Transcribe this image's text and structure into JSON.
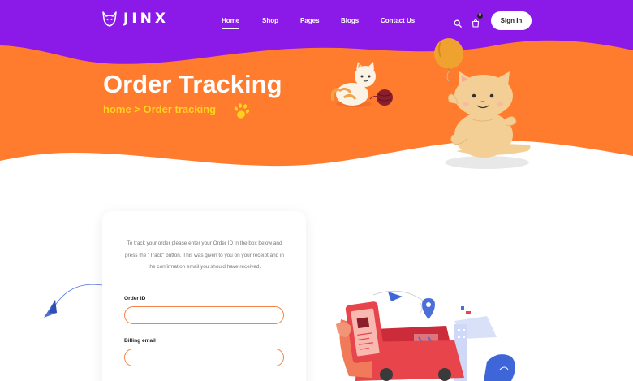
{
  "brand": {
    "name": "JINX",
    "colors": {
      "purple": "#8b1ae8",
      "orange": "#ff7b2e",
      "yellow": "#ffd21f"
    }
  },
  "nav": {
    "items": [
      {
        "label": "Home",
        "active": true
      },
      {
        "label": "Shop",
        "active": false
      },
      {
        "label": "Pages",
        "active": false
      },
      {
        "label": "Blogs",
        "active": false
      },
      {
        "label": "Contact Us",
        "active": false
      }
    ],
    "cart_count": "0",
    "signin_label": "Sign In",
    "icons": [
      "search-icon",
      "cart-icon"
    ]
  },
  "hero": {
    "title": "Order Tracking",
    "breadcrumb": {
      "home": "home",
      "separator": ">",
      "current": "Order tracking"
    }
  },
  "form": {
    "description": "To track your order please enter your Order ID in the box below and press the \"Track\" button. This was given to you on your receipt and in the confirmation email you should have received.",
    "order_id_label": "Order ID",
    "order_id_value": "",
    "billing_email_label": "Billing email",
    "billing_email_value": ""
  }
}
